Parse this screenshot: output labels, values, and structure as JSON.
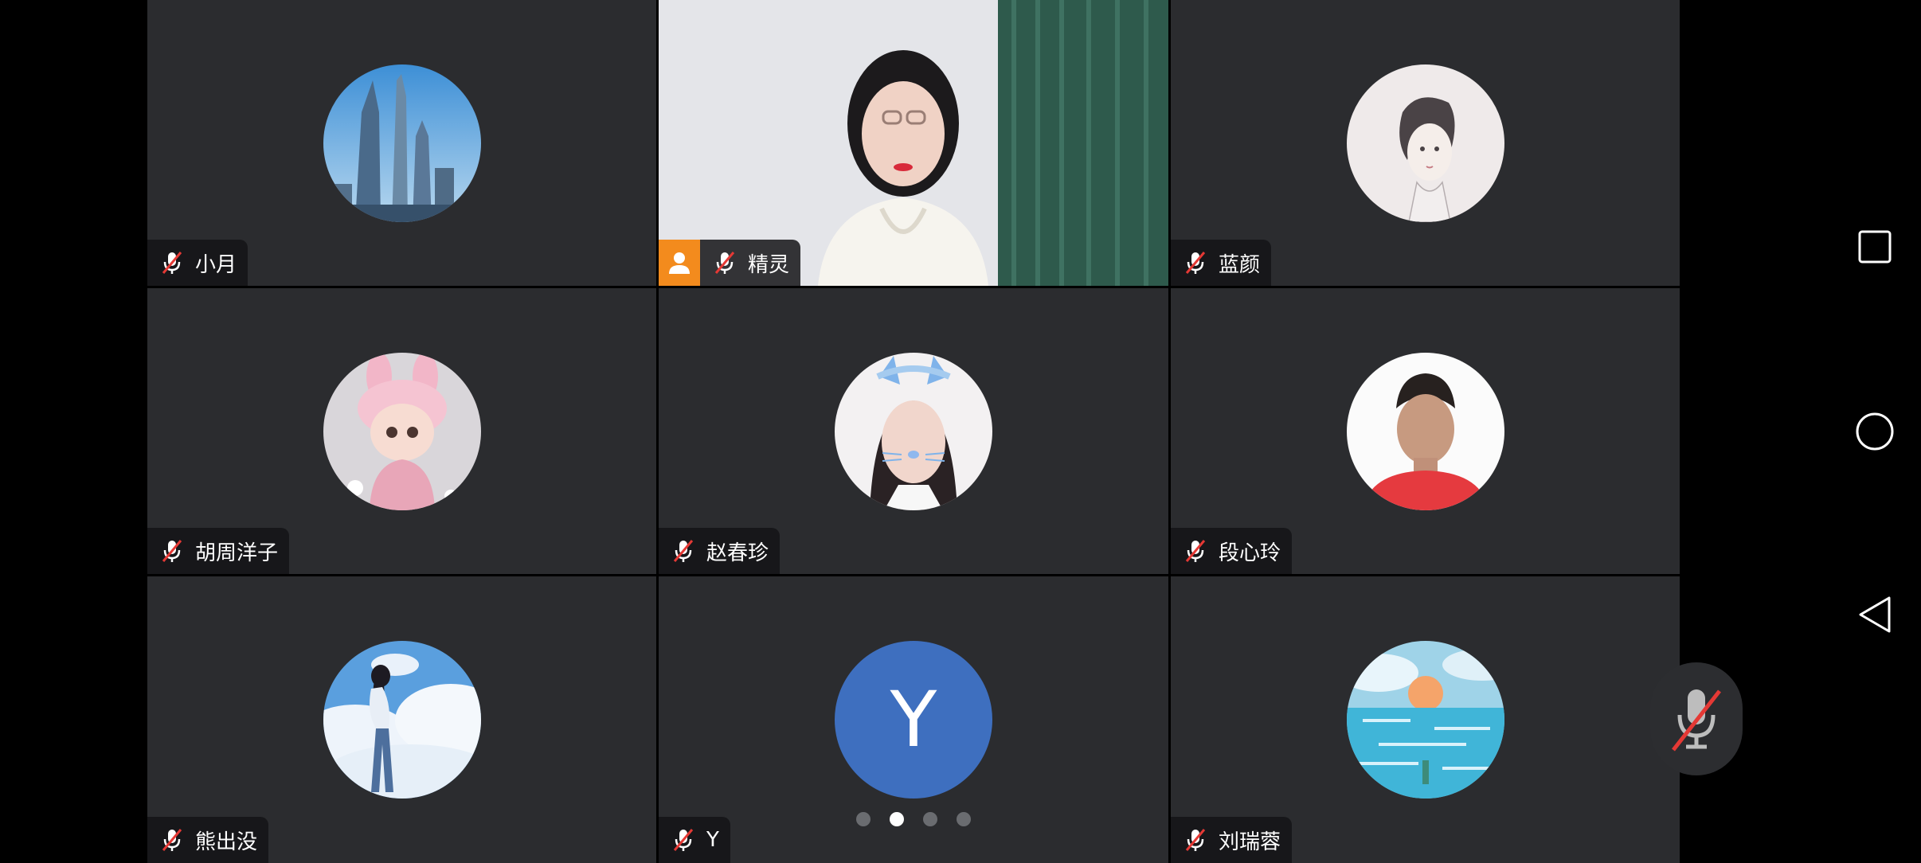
{
  "participants": [
    {
      "name": "小月",
      "avatar": "skyline-avatar",
      "muted": true
    },
    {
      "name": "精灵",
      "avatar": "camera-video",
      "muted": true,
      "host": true
    },
    {
      "name": "蓝颜",
      "avatar": "sketch-woman-avatar",
      "muted": true
    },
    {
      "name": "胡周洋子",
      "avatar": "doll-avatar",
      "muted": true
    },
    {
      "name": "赵春珍",
      "avatar": "cat-filter-selfie-avatar",
      "muted": true
    },
    {
      "name": "段心玲",
      "avatar": "portrait-red-shirt-avatar",
      "muted": true
    },
    {
      "name": "熊出没",
      "avatar": "girl-clouds-avatar",
      "muted": true
    },
    {
      "name": "Y",
      "avatar_letter": "Y",
      "muted": true
    },
    {
      "name": "刘瑞蓉",
      "avatar": "sea-sunset-avatar",
      "muted": true
    }
  ],
  "pager": {
    "pages": 4,
    "current": 2
  },
  "icons": {
    "mute": "muted-mic-icon",
    "host": "host-person-icon",
    "recents": "square-icon",
    "home": "circle-icon",
    "back": "triangle-back-icon"
  },
  "colors": {
    "tile_bg": "#2b2c2f",
    "host_badge": "#f38b1d",
    "letter_avatar": "#3e6fbf",
    "mute_slash": "#e53935"
  }
}
